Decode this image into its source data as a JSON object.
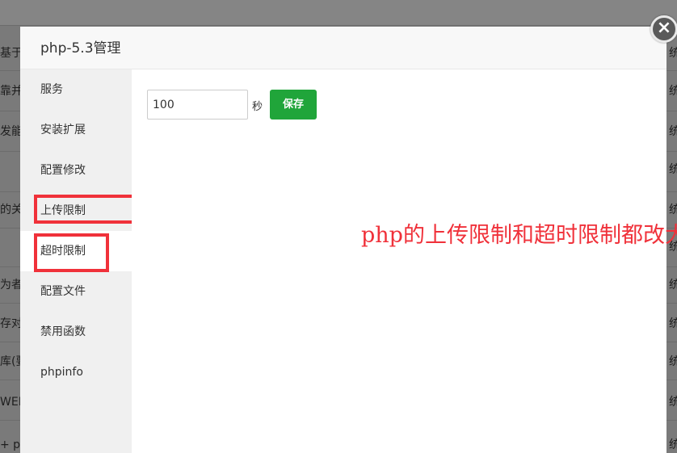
{
  "background": {
    "left_fragments": [
      "基于运",
      "靠并",
      "发能",
      "",
      "的关",
      "",
      "为者",
      "存对",
      "库(要",
      "WEB",
      "+ ph"
    ],
    "right_fragments": [
      "统",
      "统",
      "统",
      "统",
      "统",
      "统",
      "统",
      "统",
      "统",
      "统",
      "统"
    ]
  },
  "dialog": {
    "title": "php-5.3管理",
    "close_label": "×"
  },
  "sidebar": {
    "items": [
      {
        "label": "服务"
      },
      {
        "label": "安装扩展"
      },
      {
        "label": "配置修改"
      },
      {
        "label": "上传限制"
      },
      {
        "label": "超时限制"
      },
      {
        "label": "配置文件"
      },
      {
        "label": "禁用函数"
      },
      {
        "label": "phpinfo"
      }
    ]
  },
  "timeout_form": {
    "value": "100",
    "unit": "秒",
    "save_label": "保存"
  },
  "annotation": {
    "text": "php的上传限制和超时限制都改大点"
  },
  "colors": {
    "accent_green": "#20a53a",
    "annotation_red": "#f0313a",
    "overlay": "#7a7a7a"
  }
}
